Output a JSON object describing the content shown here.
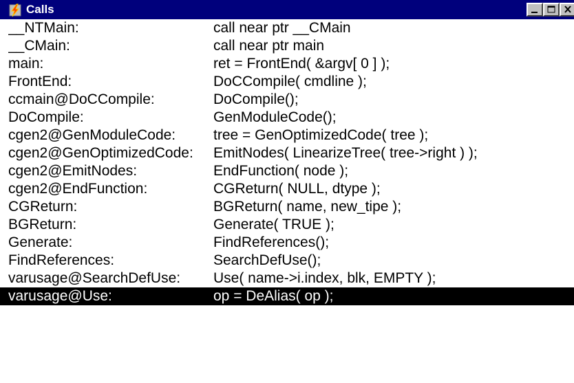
{
  "window": {
    "title": "Calls",
    "icon": "lightning-bolt-icon",
    "controls": {
      "minimize": "minimize-icon",
      "maximize": "maximize-icon",
      "close": "close-icon"
    }
  },
  "colors": {
    "titlebar": "#00007c",
    "selection_bg": "#000000",
    "selection_fg": "#ffffff"
  },
  "calls": [
    {
      "name": "__NTMain:",
      "call": "call near ptr __CMain",
      "selected": false
    },
    {
      "name": "__CMain:",
      "call": "call near ptr main",
      "selected": false
    },
    {
      "name": "main:",
      "call": "ret = FrontEnd( &argv[ 0 ] );",
      "selected": false
    },
    {
      "name": "FrontEnd:",
      "call": "DoCCompile( cmdline );",
      "selected": false
    },
    {
      "name": "ccmain@DoCCompile:",
      "call": "DoCompile();",
      "selected": false
    },
    {
      "name": "DoCompile:",
      "call": "GenModuleCode();",
      "selected": false
    },
    {
      "name": "cgen2@GenModuleCode:",
      "call": "tree = GenOptimizedCode( tree );",
      "selected": false
    },
    {
      "name": "cgen2@GenOptimizedCode:",
      "call": "EmitNodes( LinearizeTree( tree->right ) );",
      "selected": false
    },
    {
      "name": "cgen2@EmitNodes:",
      "call": "EndFunction( node );",
      "selected": false
    },
    {
      "name": "cgen2@EndFunction:",
      "call": "CGReturn( NULL, dtype );",
      "selected": false
    },
    {
      "name": "CGReturn:",
      "call": "BGReturn( name, new_tipe );",
      "selected": false
    },
    {
      "name": "BGReturn:",
      "call": "Generate( TRUE );",
      "selected": false
    },
    {
      "name": "Generate:",
      "call": "FindReferences();",
      "selected": false
    },
    {
      "name": "FindReferences:",
      "call": "SearchDefUse();",
      "selected": false
    },
    {
      "name": "varusage@SearchDefUse:",
      "call": "Use( name->i.index, blk, EMPTY );",
      "selected": false
    },
    {
      "name": "varusage@Use:",
      "call": "op = DeAlias( op );",
      "selected": true
    }
  ]
}
